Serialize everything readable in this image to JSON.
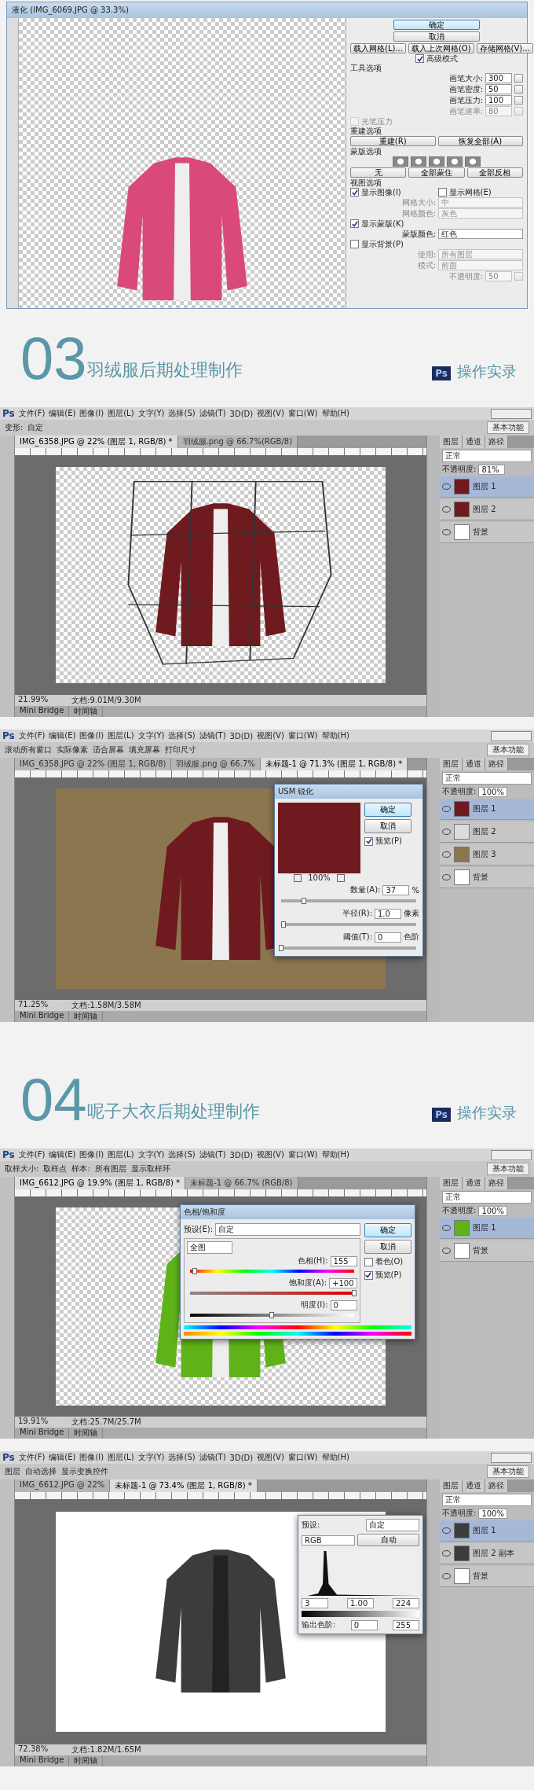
{
  "sections": [
    {
      "kind": "liquify",
      "title": "液化 (IMG_6069.JPG @ 33.3%)",
      "photo": {
        "kind": "hoodie"
      },
      "ok": "确定",
      "cancel": "取消",
      "mesh_buttons": [
        "载入网格(L)...",
        "载入上次网格(O)",
        "存储网格(V)..."
      ],
      "advanced": {
        "label": "高级模式",
        "checked": true
      },
      "rows": [
        {
          "kind": "heading",
          "label": "工具选项"
        },
        {
          "kind": "field",
          "label": "画笔大小:",
          "value": "300",
          "disabled": false
        },
        {
          "kind": "field",
          "label": "画笔密度:",
          "value": "50",
          "disabled": false
        },
        {
          "kind": "field",
          "label": "画笔压力:",
          "value": "100",
          "disabled": false
        },
        {
          "kind": "field",
          "label": "画笔速率:",
          "value": "80",
          "disabled": true
        },
        {
          "kind": "checkbox",
          "label": "光笔压力",
          "checked": false,
          "disabled": true
        },
        {
          "kind": "heading",
          "label": "重建选项"
        },
        {
          "kind": "buttons",
          "labels": [
            "重建(R)",
            "恢复全部(A)"
          ]
        },
        {
          "kind": "heading",
          "label": "蒙版选项"
        },
        {
          "kind": "masks"
        },
        {
          "kind": "buttons",
          "labels": [
            "无",
            "全部蒙住",
            "全部反相"
          ]
        },
        {
          "kind": "heading",
          "label": "视图选项"
        },
        {
          "kind": "checkpair",
          "items": [
            {
              "label": "显示图像(I)",
              "checked": true
            },
            {
              "label": "显示网格(E)",
              "checked": false
            }
          ]
        },
        {
          "kind": "select",
          "label": "网格大小:",
          "value": "中",
          "disabled": true
        },
        {
          "kind": "select",
          "label": "网格颜色:",
          "value": "灰色",
          "disabled": true
        },
        {
          "kind": "checkbox",
          "label": "显示蒙版(K)",
          "checked": true,
          "disabled": false
        },
        {
          "kind": "select",
          "label": "蒙版颜色:",
          "value": "红色",
          "disabled": false
        },
        {
          "kind": "checkbox",
          "label": "显示背景(P)",
          "checked": false,
          "disabled": false
        },
        {
          "kind": "select",
          "label": "使用:",
          "value": "所有图层",
          "disabled": true
        },
        {
          "kind": "select",
          "label": "模式:",
          "value": "前面",
          "disabled": true
        },
        {
          "kind": "field",
          "label": "不透明度:",
          "value": "50",
          "disabled": true
        }
      ]
    },
    {
      "kind": "header",
      "number": "03",
      "title": "羽绒服后期处理制作",
      "badge": "Ps",
      "caption": "操作实录"
    },
    {
      "kind": "photoshop",
      "logo": "Ps",
      "menu": [
        "文件(F)",
        "编辑(E)",
        "图像(I)",
        "图层(L)",
        "文字(Y)",
        "选择(S)",
        "滤镜(T)",
        "3D(D)",
        "视图(V)",
        "窗口(W)",
        "帮助(H)"
      ],
      "options": [
        "变形:",
        "自定"
      ],
      "workspace": "基本功能",
      "tabs": [
        {
          "label": "IMG_6358.JPG @ 22% (图层 1, RGB/8) *",
          "selected": true
        },
        {
          "label": "羽绒服.png @ 66.7%(RGB/8)",
          "selected": false
        }
      ],
      "canvas": {
        "kind": "transparent"
      },
      "photo": {
        "kind": "red-down"
      },
      "warp": true,
      "panel_tabs": [
        "图层",
        "通道",
        "路径"
      ],
      "blend": "正常",
      "opacity_label": "不透明度:",
      "opacity": "81%",
      "layers": [
        {
          "name": "图层 1",
          "selected": true,
          "color": "#6e1a1e"
        },
        {
          "name": "图层 2",
          "selected": false,
          "color": "#6e1a1e"
        },
        {
          "name": "背景",
          "selected": false,
          "color": "#ffffff"
        }
      ],
      "status_zoom": "21.99%",
      "status_doc": "文档:9.01M/9.30M",
      "bottom_tabs": [
        "Mini Bridge",
        "时间轴"
      ]
    },
    {
      "kind": "photoshop",
      "logo": "Ps",
      "menu": [
        "文件(F)",
        "编辑(E)",
        "图像(I)",
        "图层(L)",
        "文字(Y)",
        "选择(S)",
        "滤镜(T)",
        "3D(D)",
        "视图(V)",
        "窗口(W)",
        "帮助(H)"
      ],
      "options": [
        "滚动所有窗口",
        "实际像素",
        "适合屏幕",
        "填充屏幕",
        "打印尺寸"
      ],
      "workspace": "基本功能",
      "tabs": [
        {
          "label": "IMG_6358.JPG @ 22% (图层 1, RGB/8)",
          "selected": false
        },
        {
          "label": "羽绒服.png @ 66.7%",
          "selected": false
        },
        {
          "label": "未标题-1 @ 71.3% (图层 1, RGB/8) *",
          "selected": true
        }
      ],
      "canvas": {
        "kind": "tan"
      },
      "photo": {
        "kind": "red-down"
      },
      "panel_tabs": [
        "图层",
        "通道",
        "路径"
      ],
      "blend": "正常",
      "opacity_label": "不透明度:",
      "opacity": "100%",
      "layers": [
        {
          "name": "图层 1",
          "selected": true,
          "color": "#6e1a1e"
        },
        {
          "name": "图层 2",
          "selected": false,
          "color": "#dcdcdc"
        },
        {
          "name": "图层 3",
          "selected": false,
          "color": "#8c7650"
        },
        {
          "name": "背景",
          "selected": false,
          "color": "#ffffff"
        }
      ],
      "dialog": {
        "kind": "usm",
        "title": "USM 锐化",
        "ok": "确定",
        "cancel": "取消",
        "preview": {
          "label": "预览(P)",
          "checked": true
        },
        "zoom": "100%",
        "fields": [
          {
            "label": "数量(A):",
            "value": "37",
            "unit": "%",
            "level": 0.17
          },
          {
            "label": "半径(R):",
            "value": "1.0",
            "unit": "像素",
            "level": 0.02
          },
          {
            "label": "阈值(T):",
            "value": "0",
            "unit": "色阶",
            "level": 0
          }
        ]
      },
      "status_zoom": "71.25%",
      "status_doc": "文档:1.58M/3.58M",
      "bottom_tabs": [
        "Mini Bridge",
        "时间轴"
      ]
    },
    {
      "kind": "header",
      "number": "04",
      "title": "呢子大衣后期处理制作",
      "badge": "Ps",
      "caption": "操作实录"
    },
    {
      "kind": "photoshop",
      "logo": "Ps",
      "menu": [
        "文件(F)",
        "编辑(E)",
        "图像(I)",
        "图层(L)",
        "文字(Y)",
        "选择(S)",
        "滤镜(T)",
        "3D(D)",
        "视图(V)",
        "窗口(W)",
        "帮助(H)"
      ],
      "options": [
        "取样大小:",
        "取样点",
        "样本:",
        "所有图层",
        "显示取样环"
      ],
      "workspace": "基本功能",
      "tabs": [
        {
          "label": "IMG_6612.JPG @ 19.9% (图层 1, RGB/8) *",
          "selected": true
        },
        {
          "label": "未标题-1 @ 66.7% (RGB/8)",
          "selected": false
        }
      ],
      "canvas": {
        "kind": "transparent"
      },
      "photo": {
        "kind": "green-coat"
      },
      "panel_tabs": [
        "图层",
        "通道",
        "路径"
      ],
      "blend": "正常",
      "opacity_label": "不透明度:",
      "opacity": "100%",
      "layers": [
        {
          "name": "图层 1",
          "selected": true,
          "color": "#5fb318"
        },
        {
          "name": "背景",
          "selected": false,
          "color": "#ffffff"
        }
      ],
      "dialog": {
        "kind": "hue",
        "title": "色相/饱和度",
        "ok": "确定",
        "cancel": "取消",
        "preset_label": "预设(E):",
        "preset": "自定",
        "range": "全图",
        "fields": [
          {
            "label": "色相(H):",
            "value": "155",
            "kind": "hue",
            "level": 0.03
          },
          {
            "label": "饱和度(A):",
            "value": "+100",
            "kind": "sat",
            "level": 1
          },
          {
            "label": "明度(I):",
            "value": "0",
            "kind": "light",
            "level": 0.5
          }
        ],
        "checks": [
          {
            "label": "着色(O)",
            "checked": false
          },
          {
            "label": "预览(P)",
            "checked": true
          }
        ]
      },
      "status_zoom": "19.91%",
      "status_doc": "文档:25.7M/25.7M",
      "bottom_tabs": [
        "Mini Bridge",
        "时间轴"
      ]
    },
    {
      "kind": "photoshop",
      "logo": "Ps",
      "menu": [
        "文件(F)",
        "编辑(E)",
        "图像(I)",
        "图层(L)",
        "文字(Y)",
        "选择(S)",
        "滤镜(T)",
        "3D(D)",
        "视图(V)",
        "窗口(W)",
        "帮助(H)"
      ],
      "options": [
        "图层",
        "自动选择",
        "显示变换控件"
      ],
      "workspace": "基本功能",
      "tabs": [
        {
          "label": "IMG_6612.JPG @ 22%",
          "selected": false
        },
        {
          "label": "未标题-1 @ 73.4% (图层 1, RGB/8) *",
          "selected": true
        }
      ],
      "canvas": {
        "kind": "white"
      },
      "photo": {
        "kind": "grey-coat"
      },
      "panel_tabs": [
        "图层",
        "通道",
        "路径"
      ],
      "blend": "正常",
      "opacity_label": "不透明度:",
      "opacity": "100%",
      "layers": [
        {
          "name": "图层 1",
          "selected": true,
          "color": "#3c3c3c"
        },
        {
          "name": "图层 2 副本",
          "selected": false,
          "color": "#3c3c3c"
        },
        {
          "name": "背景",
          "selected": false,
          "color": "#ffffff"
        }
      ],
      "dialog": {
        "kind": "levels",
        "preset_label": "预设:",
        "preset": "自定",
        "channel": "RGB",
        "auto": "自动",
        "inputs": [
          "3",
          "1.00",
          "224"
        ],
        "output_label": "输出色阶:",
        "outputs": [
          "0",
          "255"
        ]
      },
      "status_zoom": "72.38%",
      "status_doc": "文档:1.82M/1.65M",
      "bottom_tabs": [
        "Mini Bridge",
        "时间轴"
      ]
    }
  ]
}
